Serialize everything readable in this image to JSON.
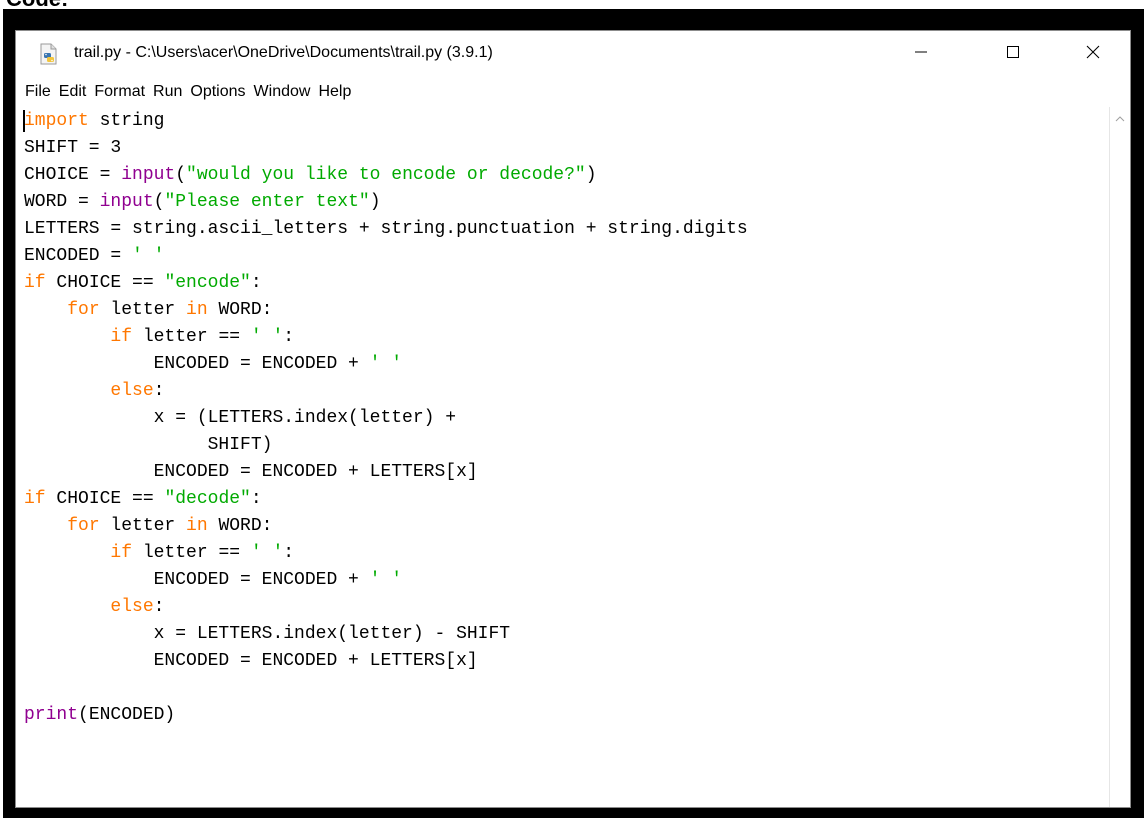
{
  "caption": "Code:",
  "window": {
    "title": "trail.py - C:\\Users\\acer\\OneDrive\\Documents\\trail.py (3.9.1)",
    "icons": {
      "app": "python-file-icon",
      "minimize": "minimize-icon",
      "maximize": "maximize-icon",
      "close": "close-icon"
    }
  },
  "menu": [
    "File",
    "Edit",
    "Format",
    "Run",
    "Options",
    "Window",
    "Help"
  ],
  "code": [
    [
      [
        "kw",
        "import"
      ],
      [
        "",
        " string"
      ]
    ],
    [
      [
        "",
        "SHIFT = 3"
      ]
    ],
    [
      [
        "",
        "CHOICE = "
      ],
      [
        "bi",
        "input"
      ],
      [
        "",
        "("
      ],
      [
        "st",
        "\"would you like to encode or decode?\""
      ],
      [
        "",
        ")"
      ]
    ],
    [
      [
        "",
        "WORD = "
      ],
      [
        "bi",
        "input"
      ],
      [
        "",
        "("
      ],
      [
        "st",
        "\"Please enter text\""
      ],
      [
        "",
        ")"
      ]
    ],
    [
      [
        "",
        "LETTERS = string.ascii_letters + string.punctuation + string.digits"
      ]
    ],
    [
      [
        "",
        "ENCODED = "
      ],
      [
        "st",
        "' '"
      ]
    ],
    [
      [
        "kw",
        "if"
      ],
      [
        "",
        " CHOICE == "
      ],
      [
        "st",
        "\"encode\""
      ],
      [
        "",
        ":"
      ]
    ],
    [
      [
        "",
        "    "
      ],
      [
        "kw",
        "for"
      ],
      [
        "",
        " letter "
      ],
      [
        "kw",
        "in"
      ],
      [
        "",
        " WORD:"
      ]
    ],
    [
      [
        "",
        "        "
      ],
      [
        "kw",
        "if"
      ],
      [
        "",
        " letter == "
      ],
      [
        "st",
        "' '"
      ],
      [
        "",
        ":"
      ]
    ],
    [
      [
        "",
        "            ENCODED = ENCODED + "
      ],
      [
        "st",
        "' '"
      ]
    ],
    [
      [
        "",
        "        "
      ],
      [
        "kw",
        "else"
      ],
      [
        "",
        ":"
      ]
    ],
    [
      [
        "",
        "            x = (LETTERS.index(letter) +"
      ]
    ],
    [
      [
        "",
        "                 SHIFT)"
      ]
    ],
    [
      [
        "",
        "            ENCODED = ENCODED + LETTERS[x]"
      ]
    ],
    [
      [
        "kw",
        "if"
      ],
      [
        "",
        " CHOICE == "
      ],
      [
        "st",
        "\"decode\""
      ],
      [
        "",
        ":"
      ]
    ],
    [
      [
        "",
        "    "
      ],
      [
        "kw",
        "for"
      ],
      [
        "",
        " letter "
      ],
      [
        "kw",
        "in"
      ],
      [
        "",
        " WORD:"
      ]
    ],
    [
      [
        "",
        "        "
      ],
      [
        "kw",
        "if"
      ],
      [
        "",
        " letter == "
      ],
      [
        "st",
        "' '"
      ],
      [
        "",
        ":"
      ]
    ],
    [
      [
        "",
        "            ENCODED = ENCODED + "
      ],
      [
        "st",
        "' '"
      ]
    ],
    [
      [
        "",
        "        "
      ],
      [
        "kw",
        "else"
      ],
      [
        "",
        ":"
      ]
    ],
    [
      [
        "",
        "            x = LETTERS.index(letter) - SHIFT"
      ]
    ],
    [
      [
        "",
        "            ENCODED = ENCODED + LETTERS[x]"
      ]
    ],
    [
      [
        "",
        ""
      ]
    ],
    [
      [
        "bi",
        "print"
      ],
      [
        "",
        "(ENCODED)"
      ]
    ]
  ],
  "colors": {
    "keyword": "#ff7700",
    "builtin": "#900090",
    "string": "#00aa00",
    "text": "#000000"
  }
}
